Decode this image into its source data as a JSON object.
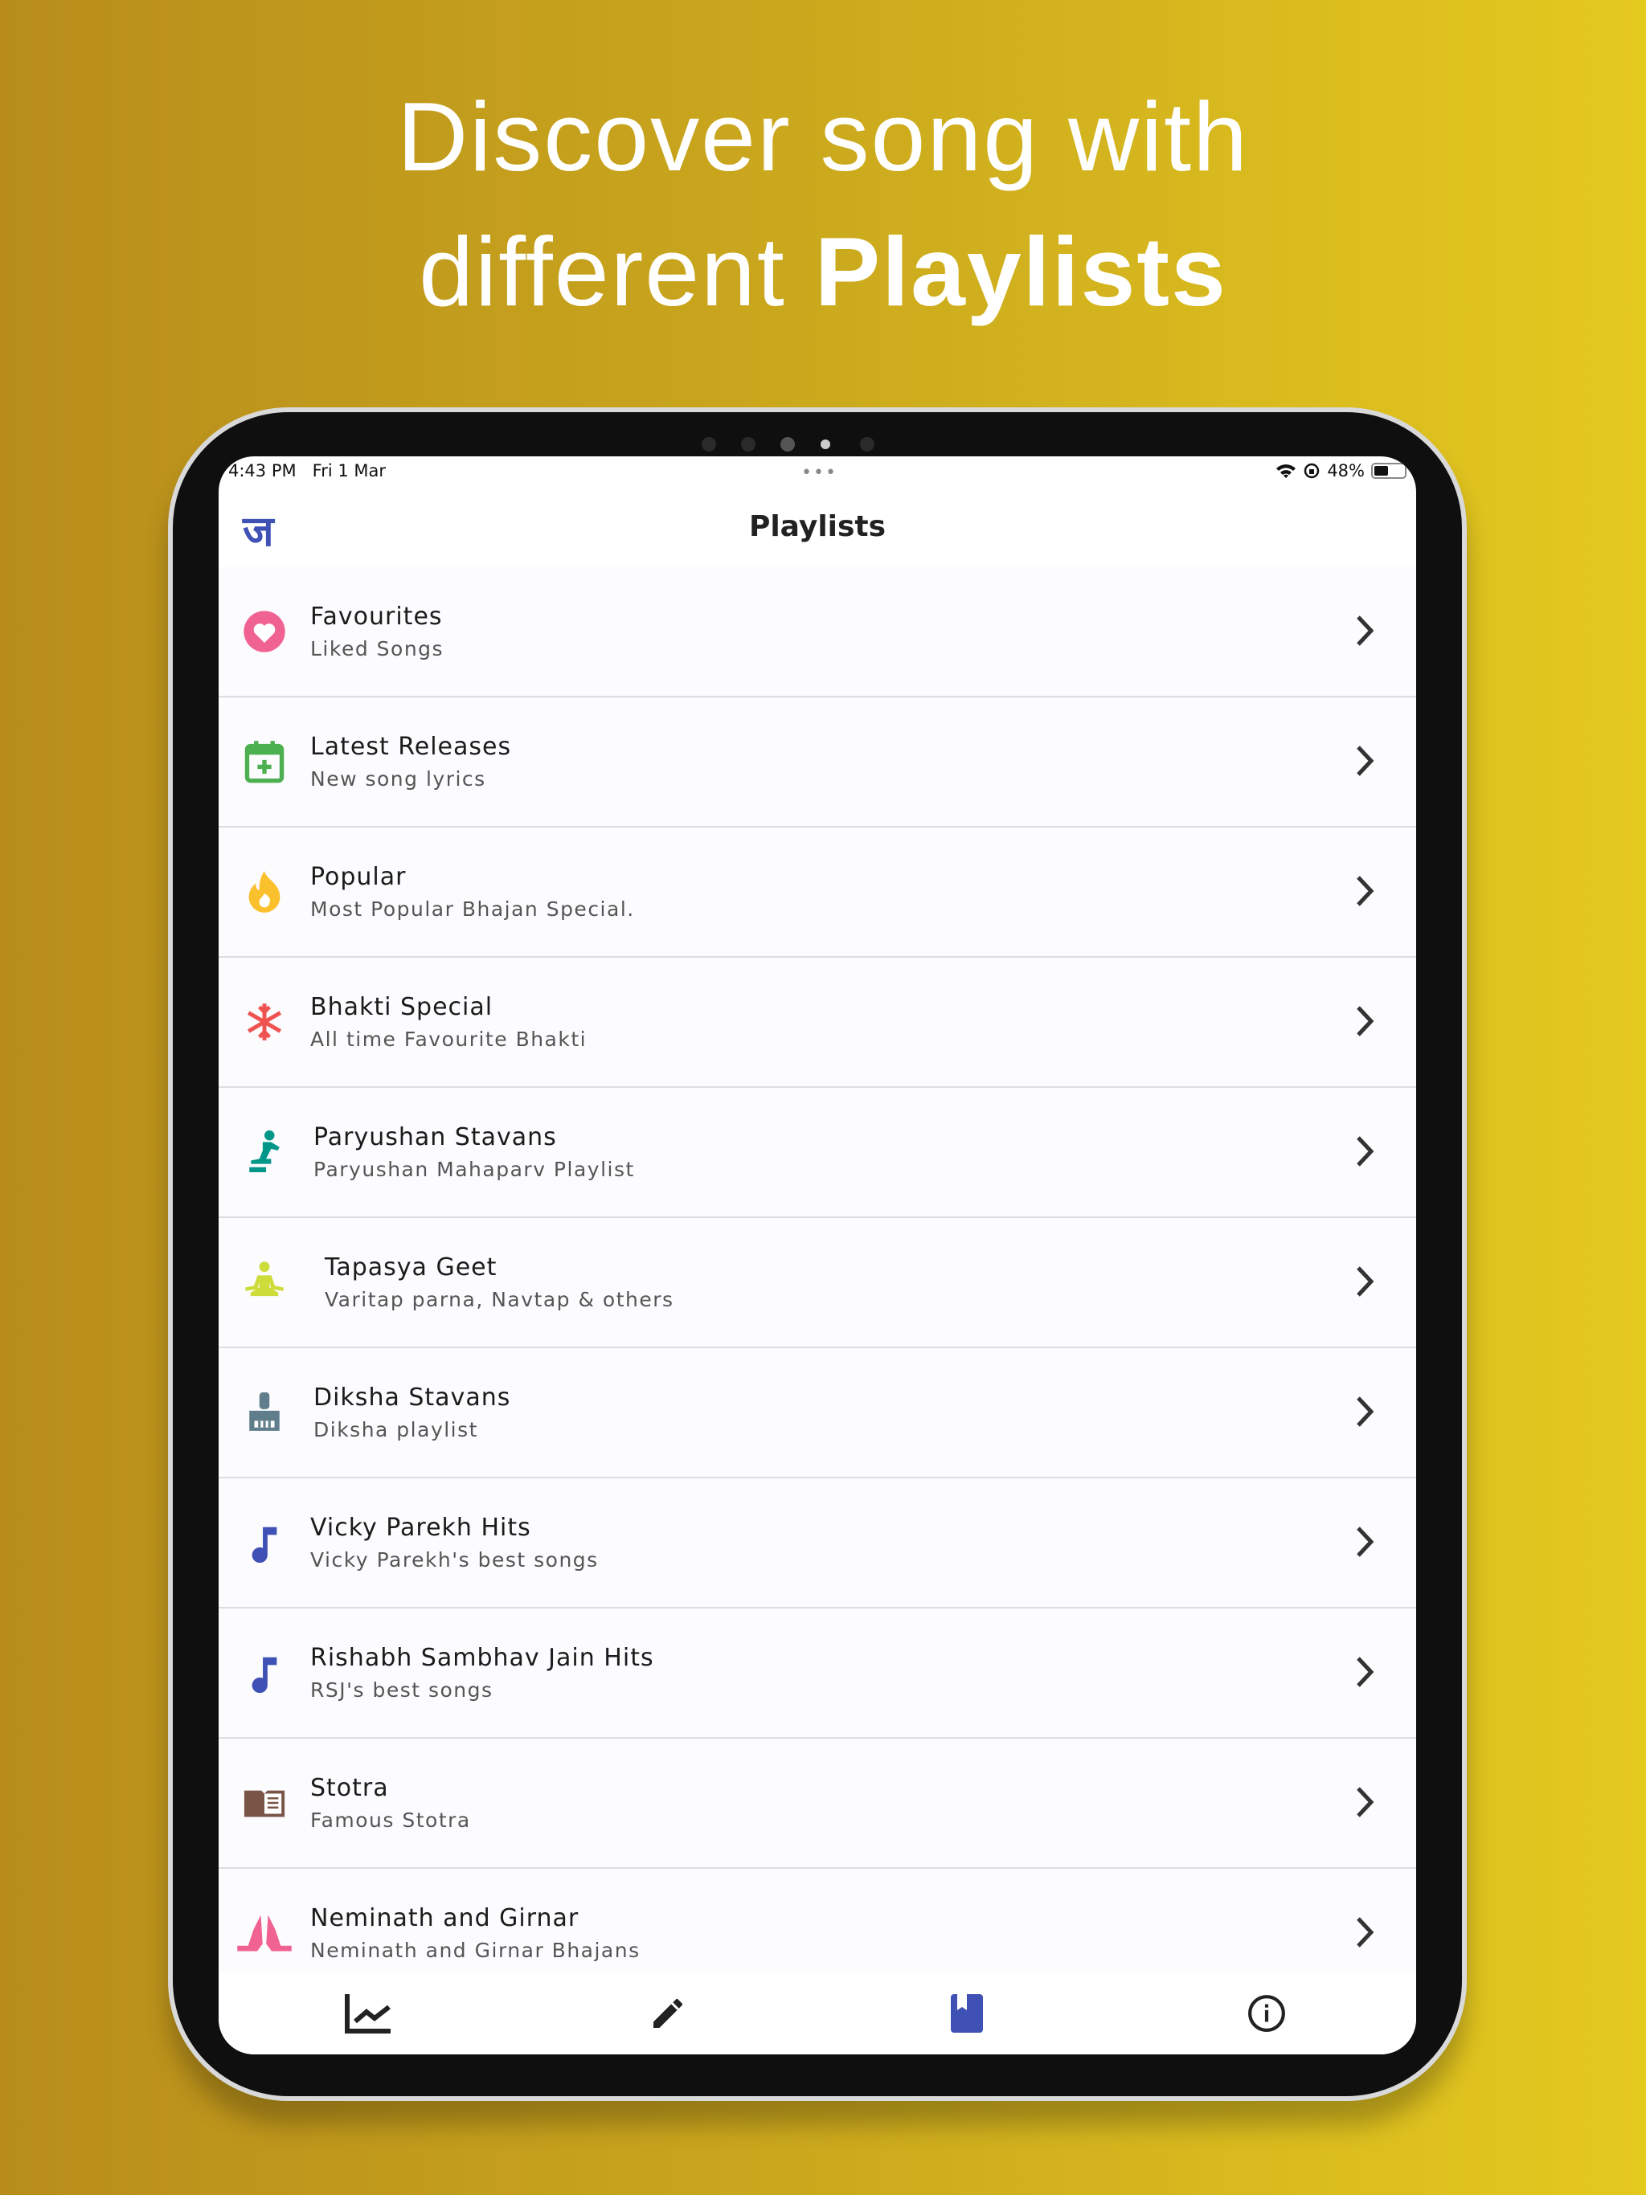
{
  "headline": {
    "line1": "Discover song with",
    "line2_prefix": "different ",
    "line2_bold": "Playlists"
  },
  "status": {
    "time": "4:43 PM",
    "date": "Fri 1 Mar",
    "battery": "48%",
    "battery_level": 0.48
  },
  "header": {
    "logo": "ज",
    "title": "Playlists"
  },
  "colors": {
    "accent": "#3f51b5",
    "bg_left": "#b88d1b",
    "bg_right": "#e4c91f"
  },
  "playlists": [
    {
      "title": "Favourites",
      "subtitle": "Liked Songs",
      "icon": "heart-icon",
      "color": "#f06292"
    },
    {
      "title": "Latest Releases",
      "subtitle": "New song lyrics",
      "icon": "calendar-add-icon",
      "color": "#4caf50"
    },
    {
      "title": "Popular",
      "subtitle": "Most Popular Bhajan Special.",
      "icon": "fire-icon",
      "color": "#fbc02d"
    },
    {
      "title": "Bhakti Special",
      "subtitle": "All time Favourite Bhakti",
      "icon": "snowflake-icon",
      "color": "#ef5350"
    },
    {
      "title": "Paryushan Stavans",
      "subtitle": "Paryushan Mahaparv Playlist",
      "icon": "kneeling-person-icon",
      "color": "#009688"
    },
    {
      "title": "Tapasya Geet",
      "subtitle": "Varitap parna, Navtap & others",
      "icon": "meditation-icon",
      "color": "#cddc39"
    },
    {
      "title": "Diksha Stavans",
      "subtitle": "Diksha playlist",
      "icon": "broom-icon",
      "color": "#607d8b"
    },
    {
      "title": "Vicky Parekh Hits",
      "subtitle": "Vicky Parekh's best songs",
      "icon": "music-note-icon",
      "color": "#3f51b5"
    },
    {
      "title": "Rishabh Sambhav Jain Hits",
      "subtitle": "RSJ's best songs",
      "icon": "music-note-icon",
      "color": "#3f51b5"
    },
    {
      "title": "Stotra",
      "subtitle": "Famous Stotra",
      "icon": "book-icon",
      "color": "#795548"
    },
    {
      "title": "Neminath and Girnar",
      "subtitle": "Neminath and Girnar Bhajans",
      "icon": "praying-hands-icon",
      "color": "#f06292"
    }
  ],
  "bottom_nav": [
    {
      "icon": "chart-icon",
      "active": false
    },
    {
      "icon": "pencil-icon",
      "active": false
    },
    {
      "icon": "book-icon",
      "active": true
    },
    {
      "icon": "info-icon",
      "active": false
    }
  ]
}
